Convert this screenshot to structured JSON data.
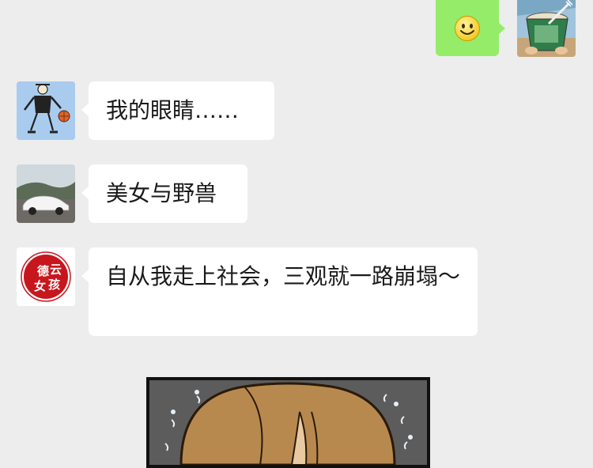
{
  "sent": {
    "emoji": "smiley-face"
  },
  "messages": [
    {
      "sender_avatar": "sketch-figure-basketball",
      "text": "我的眼睛……"
    },
    {
      "sender_avatar": "white-sports-car",
      "text": "美女与野兽"
    },
    {
      "sender_avatar": "seal-logo",
      "logo_text": "德云女孩",
      "text": "自从我走上社会，三观就一路崩塌～"
    }
  ],
  "comic_panel": {
    "content": "brown-haired-character-top-of-head"
  }
}
